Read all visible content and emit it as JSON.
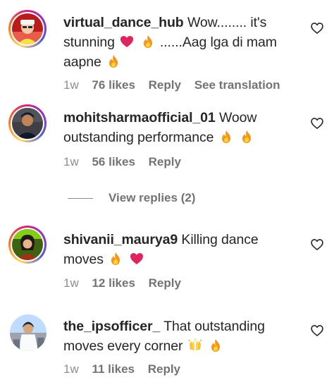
{
  "comments": [
    {
      "username": "virtual_dance_hub",
      "text_a": "Wow........ it's stunning",
      "text_b": "......Aag lga di mam aapne",
      "time": "1w",
      "likes": "76 likes",
      "reply": "Reply",
      "translate": "See translation"
    },
    {
      "username": "mohitsharmaofficial_01",
      "text_a": "Woow outstanding performance",
      "time": "1w",
      "likes": "56 likes",
      "reply": "Reply"
    },
    {
      "username": "shivanii_maurya9",
      "text_a": "Killing dance moves",
      "time": "1w",
      "likes": "12 likes",
      "reply": "Reply"
    },
    {
      "username": "the_ipsofficer_",
      "text_a": "That outstanding moves every corner",
      "time": "1w",
      "likes": "11 likes",
      "reply": "Reply"
    }
  ],
  "view_replies": "View replies (2)",
  "colors": {
    "text": "#262626",
    "meta": "#8e8e8e",
    "heart": "#e0245e",
    "fire": "#f97316"
  },
  "icons": [
    "heart-outline-icon",
    "red-heart-emoji",
    "fire-emoji",
    "raising-hands-emoji"
  ]
}
